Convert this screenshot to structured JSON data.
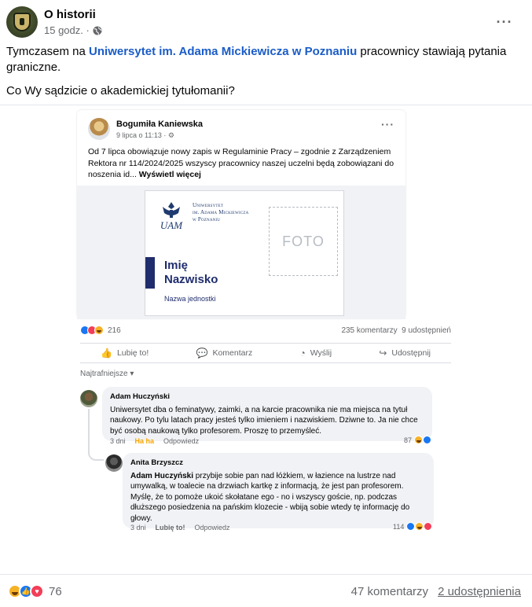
{
  "post": {
    "page_name": "O historii",
    "time": "15 godz. ·",
    "text_before_link": "Tymczasem na ",
    "link_text": "Uniwersytet im. Adama Mickiewicza w Poznaniu",
    "text_after_link": " pracownicy stawiają pytania graniczne.",
    "question": "Co Wy sądzicie o akademickiej tytułomanii?"
  },
  "inner_post": {
    "author": "Bogumiła Kaniewska",
    "time": "9 lipca o 11:13 · ⚙",
    "text": "Od 7 lipca obowiązuje nowy zapis w Regulaminie Pracy – zgodnie z Zarządzeniem Rektora nr 114/2024/2025 wszyscy pracownicy naszej uczelni będą zobowiązani do noszenia id... ",
    "see_more": "Wyświetl więcej",
    "card": {
      "uni_line1": "Uniwersytet",
      "uni_line2": "im. Adama Mickiewicza",
      "uni_line3": "w Poznaniu",
      "logo_text": "UAM",
      "photo": "FOTO",
      "name_line1": "Imię",
      "name_line2": "Nazwisko",
      "unit": "Nazwa jednostki"
    },
    "reactions_count": "216",
    "comments_count": "235 komentarzy",
    "shares": "9 udostępnień",
    "actions": {
      "like": "Lubię to!",
      "comment": "Komentarz",
      "send": "Wyślij",
      "share": "Udostępnij"
    },
    "sort": "Najtrafniejsze ▾",
    "comments": [
      {
        "author": "Adam Huczyński",
        "text": "Uniwersytet dba o feminatywy, zaimki, a na karcie pracownika nie ma miejsca na tytuł naukowy. Po tylu latach pracy jesteś tylko imieniem i nazwiskiem. Dziwne to. Ja nie chce być osobą naukową tylko profesorem. Proszę to przemyśleć.",
        "time": "3 dni",
        "reaction_label": "Ha ha",
        "reply": "Odpowiedz",
        "reactions": "87"
      },
      {
        "author": "Anita Brzyszcz",
        "mention": "Adam Huczyński",
        "text": " przybije sobie pan nad łóżkiem, w łazience na lustrze nad umywalką, w toalecie na drzwiach kartkę z informacją, że jest pan profesorem. Myślę, że to pomoże ukoić skołatane ego - no i wszyscy goście, np. podczas dłuższego posiedzenia na pańskim klozecie - wbiją sobie wtedy tę informację do głowy.",
        "time": "3 dni",
        "reaction_label": "Lubię to!",
        "reply": "Odpowiedz",
        "reactions": "114"
      }
    ]
  },
  "footer": {
    "reactions_count": "76",
    "comments": "47 komentarzy",
    "shares": "2 udostępnienia"
  },
  "colors": {
    "link": "#1a5cc8",
    "like": "#1877f2",
    "love": "#f33e58",
    "haha": "#f7b125",
    "uam_navy": "#1f2d6d"
  }
}
